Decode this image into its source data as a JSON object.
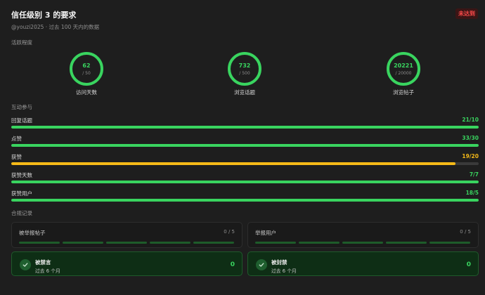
{
  "header": {
    "title": "信任级别 3 的要求",
    "status_badge": "未达到",
    "subtitle": "@youzi2025 · 过去 100 天内的数据"
  },
  "activity": {
    "section_label": "活跃程度",
    "items": [
      {
        "value": "62",
        "target": "/ 50",
        "label": "访问天数"
      },
      {
        "value": "732",
        "target": "/ 500",
        "label": "浏览话题"
      },
      {
        "value": "20221",
        "target": "/ 20000",
        "label": "浏览帖子"
      }
    ]
  },
  "interaction": {
    "section_label": "互动参与",
    "bars": [
      {
        "label": "回复话题",
        "value_text": "21/10",
        "progress": 1.0,
        "status": "met"
      },
      {
        "label": "点赞",
        "value_text": "33/30",
        "progress": 1.0,
        "status": "met"
      },
      {
        "label": "获赞",
        "value_text": "19/20",
        "progress": 0.95,
        "status": "unmet"
      },
      {
        "label": "获赞天数",
        "value_text": "7/7",
        "progress": 1.0,
        "status": "met"
      },
      {
        "label": "获赞用户",
        "value_text": "18/5",
        "progress": 1.0,
        "status": "met"
      }
    ]
  },
  "compliance": {
    "section_label": "合规记录",
    "reports": [
      {
        "label": "被举报帖子",
        "count": "0 / 5"
      },
      {
        "label": "举报用户",
        "count": "0 / 5"
      }
    ],
    "penalties": [
      {
        "title": "被禁言",
        "subtitle": "过去 6 个月",
        "count": "0"
      },
      {
        "title": "被封禁",
        "subtitle": "过去 6 个月",
        "count": "0"
      }
    ]
  },
  "colors": {
    "met": "#39d45f",
    "unmet": "#f5b918",
    "danger": "#ff4b4b",
    "background": "#1e1e1e"
  },
  "icons": {
    "penalty": "checkmark-icon"
  }
}
